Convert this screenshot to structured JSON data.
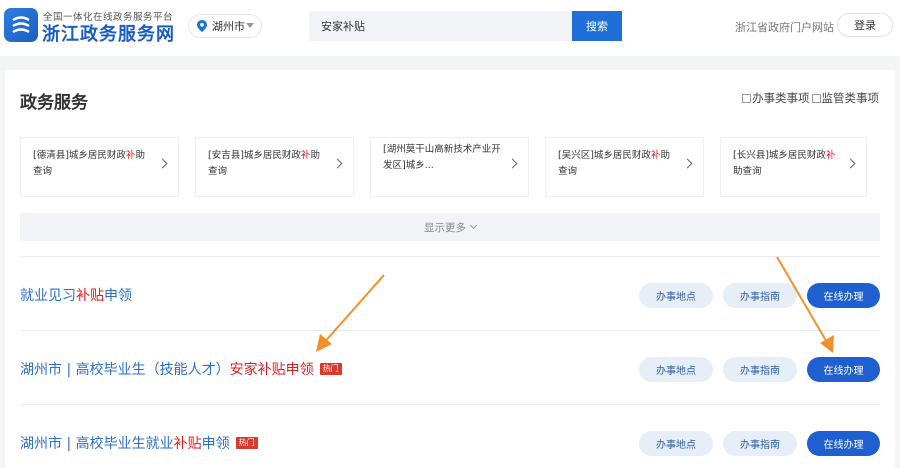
{
  "header": {
    "brand_sub": "全国一体化在线政务服务平台",
    "brand_main": "浙江政务服务网",
    "city": "湖州市",
    "search_value": "安家补贴",
    "search_button": "搜索",
    "portal_link": "浙江省政府门户网站",
    "login_button": "登录"
  },
  "section": {
    "title": "政务服务",
    "filters": [
      "办事类事项",
      "监管类事项"
    ],
    "tiles": [
      {
        "pre": "[德清县]城乡居民财政",
        "hl": "补",
        "post": "助查询"
      },
      {
        "pre": "[安吉县]城乡居民财政",
        "hl": "补",
        "post": "助查询"
      },
      {
        "pre": "[湖州莫干山高新技术产业开发区]城乡...",
        "hl": "",
        "post": ""
      },
      {
        "pre": "[吴兴区]城乡居民财政",
        "hl": "补",
        "post": "助查询"
      },
      {
        "pre": "[长兴县]城乡居民财政",
        "hl": "补",
        "post": "助查询"
      }
    ],
    "show_more": "显示更多"
  },
  "results": [
    {
      "pre": "就业见习",
      "hl": "补贴",
      "post": "申领",
      "hot": ""
    },
    {
      "pre": "湖州市 | 高校毕业生（技能人才）",
      "hl": "安家补贴",
      "post": "申领",
      "hot": "热门"
    },
    {
      "pre": "湖州市 | 高校毕业生就业",
      "hl": "补贴",
      "post": "申领",
      "hot": "热门"
    }
  ],
  "actions": {
    "location": "办事地点",
    "guide": "办事指南",
    "online": "在线办理"
  },
  "colors": {
    "primary": "#1f5fcf",
    "highlight": "#e02020",
    "annotation_arrow": "#f0902a"
  }
}
